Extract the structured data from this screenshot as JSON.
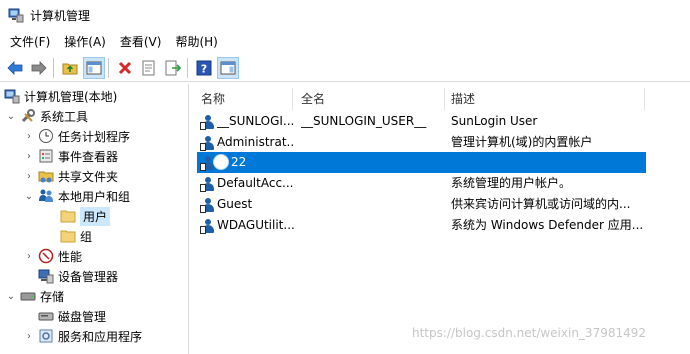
{
  "window": {
    "title": "计算机管理"
  },
  "menu": [
    "文件(F)",
    "操作(A)",
    "查看(V)",
    "帮助(H)"
  ],
  "toolbar": {
    "buttons": [
      "back-icon",
      "forward-icon",
      "up-folder-icon",
      "show-hide-tree-icon",
      "delete-icon",
      "properties-icon",
      "export-icon",
      "help-icon",
      "action-pane-icon"
    ],
    "pressed": "show-hide-tree-icon"
  },
  "tree": {
    "root": "计算机管理(本地)",
    "items": [
      {
        "label": "系统工具",
        "expander": "⌄",
        "icon": "tools-icon"
      },
      {
        "label": "任务计划程序",
        "expander": "›",
        "icon": "clock-icon"
      },
      {
        "label": "事件查看器",
        "expander": "›",
        "icon": "event-viewer-icon"
      },
      {
        "label": "共享文件夹",
        "expander": "›",
        "icon": "shared-folder-icon"
      },
      {
        "label": "本地用户和组",
        "expander": "⌄",
        "icon": "users-group-icon"
      },
      {
        "label": "用户",
        "expander": "",
        "icon": "folder-icon"
      },
      {
        "label": "组",
        "expander": "",
        "icon": "folder-icon"
      },
      {
        "label": "性能",
        "expander": "›",
        "icon": "performance-icon"
      },
      {
        "label": "设备管理器",
        "expander": "",
        "icon": "device-manager-icon"
      },
      {
        "label": "存储",
        "expander": "⌄",
        "icon": "storage-icon"
      },
      {
        "label": "磁盘管理",
        "expander": "",
        "icon": "disk-icon"
      },
      {
        "label": "服务和应用程序",
        "expander": "›",
        "icon": "services-icon"
      }
    ],
    "selected": "用户"
  },
  "list": {
    "columns": [
      "名称",
      "全名",
      "描述"
    ],
    "rows": [
      {
        "name": "__SUNLOGI...",
        "fullname": "__SUNLOGIN_USER__",
        "desc": "SunLogin User"
      },
      {
        "name": "Administrat...",
        "fullname": "",
        "desc": "管理计算机(域)的内置帐户"
      },
      {
        "name": "22",
        "fullname": "",
        "desc": "",
        "selected": true
      },
      {
        "name": "DefaultAcc...",
        "fullname": "",
        "desc": "系统管理的用户帐户。"
      },
      {
        "name": "Guest",
        "fullname": "",
        "desc": "供来宾访问计算机或访问域的内..."
      },
      {
        "name": "WDAGUtilit...",
        "fullname": "",
        "desc": "系统为 Windows Defender 应用..."
      }
    ]
  },
  "watermark": "https://blog.csdn.net/weixin_37981492",
  "colors": {
    "selection": "#0078d7",
    "tree_selection": "#cce8ff",
    "icon_blue": "#1f5fa9"
  }
}
